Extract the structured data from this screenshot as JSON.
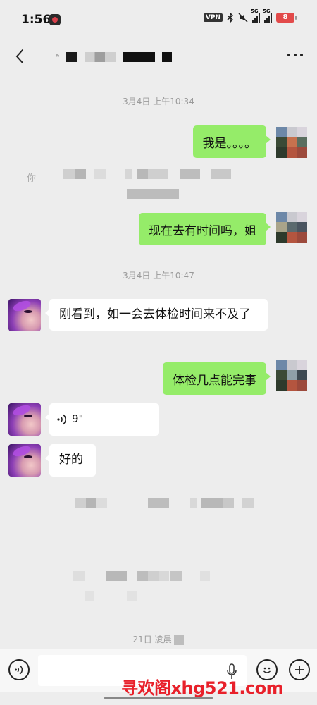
{
  "status_bar": {
    "time": "1:56",
    "vpn": "VPN",
    "network1": "5G",
    "network2": "5G",
    "battery": "8"
  },
  "chat": {
    "messages": [
      {
        "type": "timestamp",
        "text": "3月4日 上午10:34"
      },
      {
        "type": "outgoing",
        "text": "我是。。。。"
      },
      {
        "type": "system_redacted",
        "text": "你"
      },
      {
        "type": "outgoing",
        "text": "现在去有时间吗，姐"
      },
      {
        "type": "timestamp",
        "text": "3月4日 上午10:47"
      },
      {
        "type": "incoming",
        "text": "刚看到，如一会去体检时间来不及了"
      },
      {
        "type": "outgoing",
        "text": "体检几点能完事"
      },
      {
        "type": "incoming_voice",
        "duration": "9\""
      },
      {
        "type": "incoming",
        "text": "好的"
      },
      {
        "type": "timestamp_redacted",
        "text": "21日 凌晨"
      }
    ]
  },
  "input_bar": {
    "placeholder": ""
  },
  "watermark": "寻欢阁xhg521.com",
  "colors": {
    "outgoing_bubble": "#95ec69",
    "incoming_bubble": "#ffffff",
    "background": "#ededed",
    "watermark": "#e8202a"
  },
  "icons": [
    "back-icon",
    "more-icon",
    "voice-toggle-icon",
    "microphone-icon",
    "emoji-icon",
    "plus-icon",
    "voice-wave-icon",
    "bluetooth-icon",
    "mute-icon"
  ]
}
